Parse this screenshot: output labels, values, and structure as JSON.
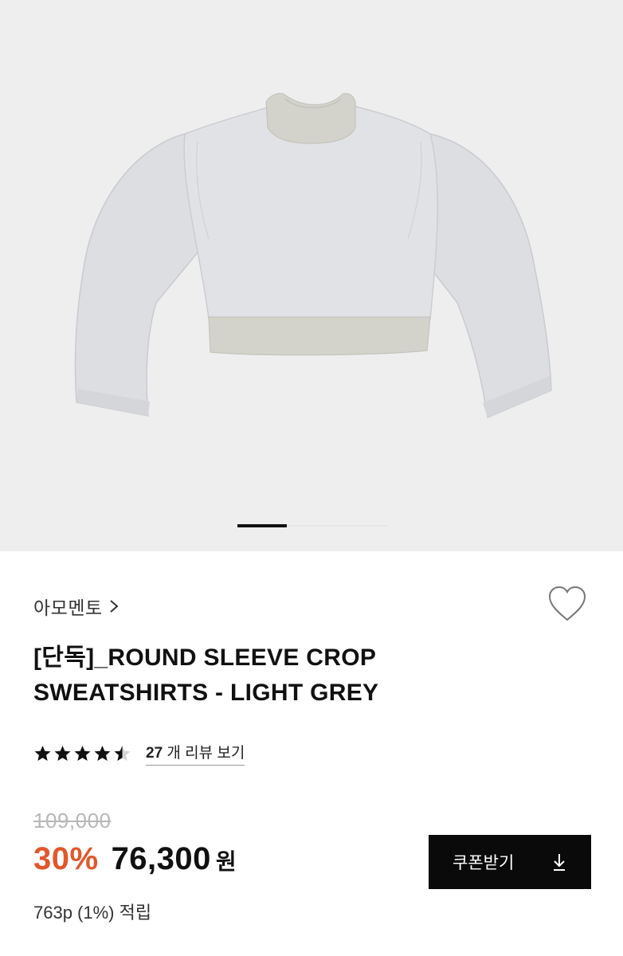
{
  "product_image": {
    "name": "light-grey-crop-sweatshirt",
    "background": "#eeeeee",
    "body_color": "#d9dbdf",
    "rib_color": "#cfcfc8"
  },
  "carousel": {
    "active_index": 1,
    "total": 3
  },
  "brand": {
    "name": "아모멘토",
    "arrow_icon": "chevron-right-icon"
  },
  "wishlist": {
    "icon": "heart-outline-icon"
  },
  "product": {
    "title_line1": "[단독]_ROUND SLEEVE CROP",
    "title_line2": "SWEATSHIRTS - LIGHT GREY"
  },
  "rating": {
    "value": 4.5,
    "max": 5,
    "star_icon": "star-icon",
    "review_count": "27",
    "review_text": " 개 리뷰 보기"
  },
  "pricing": {
    "original_price": "109,000",
    "discount_rate": "30%",
    "sale_price": "76,300",
    "currency": "원",
    "points_text": "763p (1%) 적립",
    "discount_color": "#e2572a"
  },
  "coupon": {
    "label": "쿠폰받기",
    "icon": "download-icon"
  }
}
